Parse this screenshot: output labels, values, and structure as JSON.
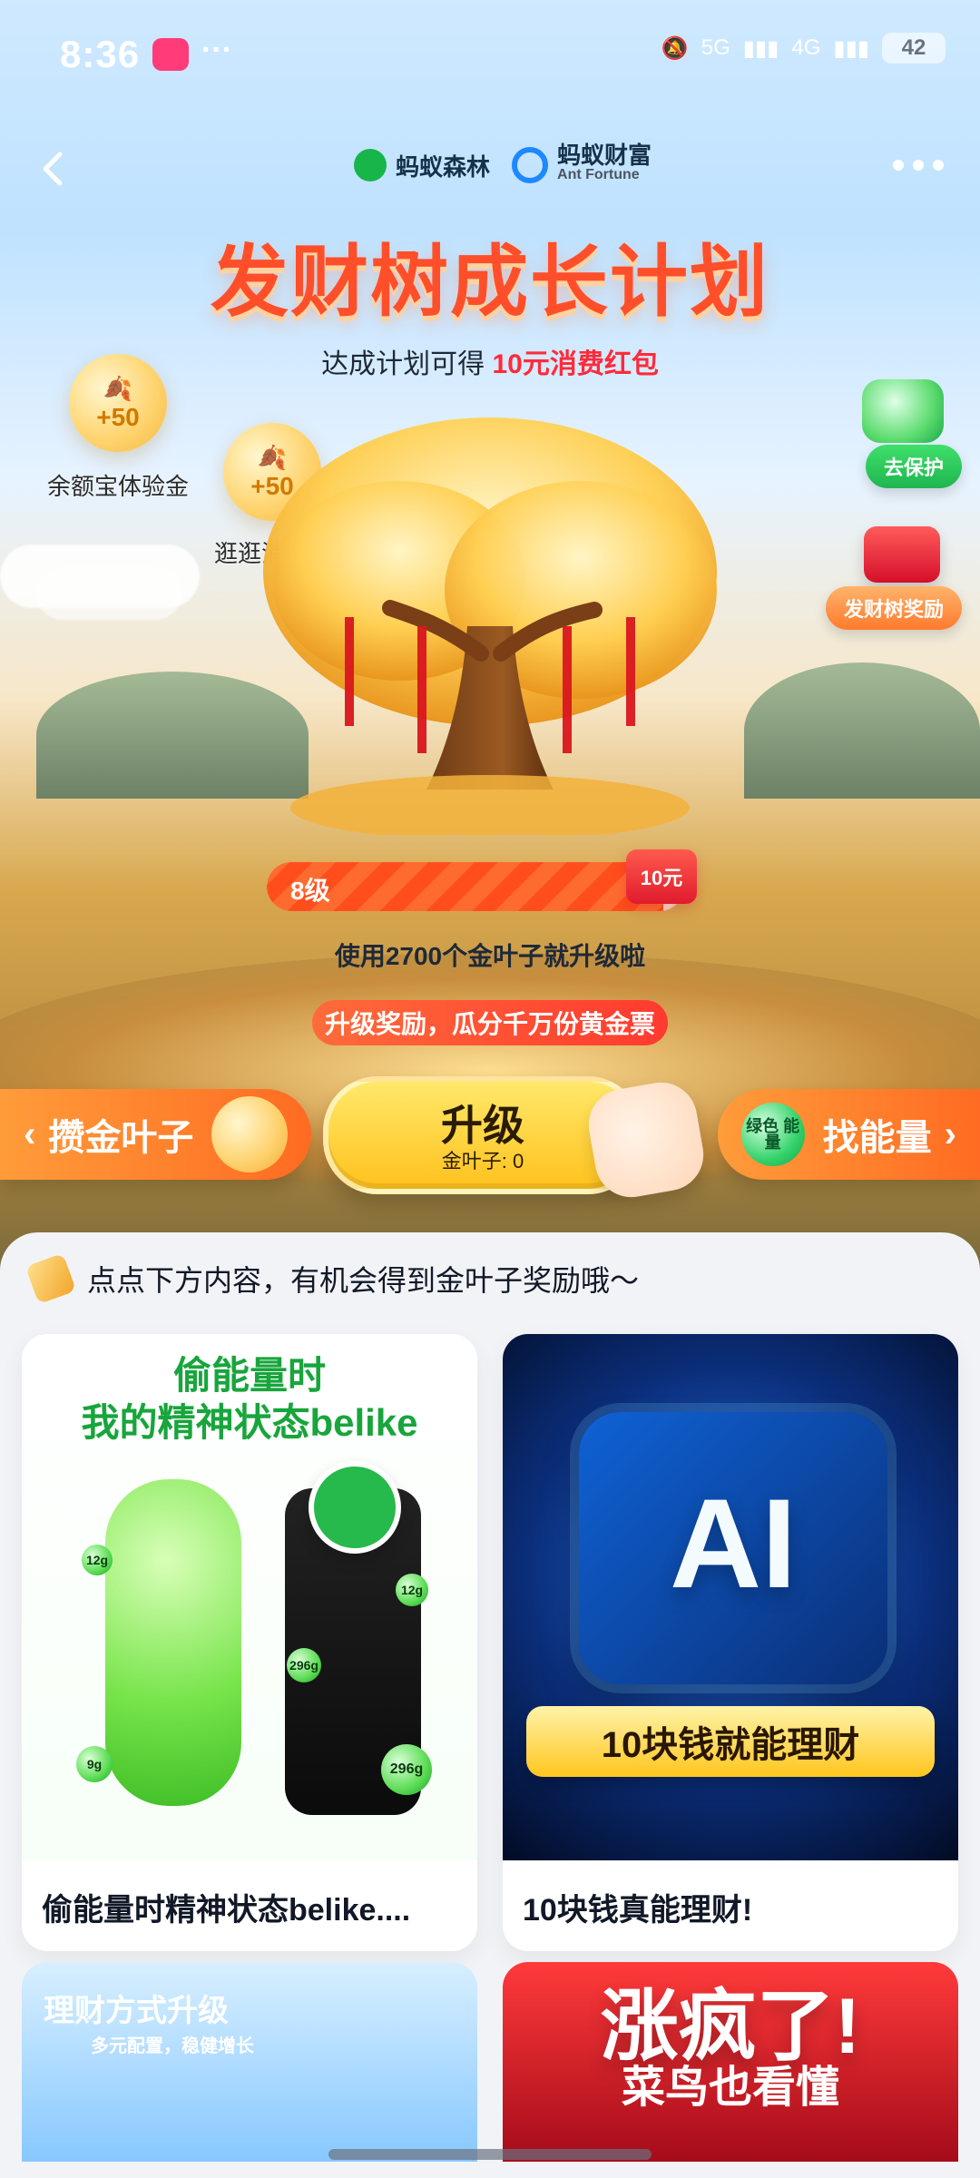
{
  "status_bar": {
    "time": "8:36",
    "extra": "···",
    "network_1": "5G",
    "network_2": "4G",
    "battery": "42"
  },
  "nav": {
    "brand_1": "蚂蚁森林",
    "brand_2": "蚂蚁财富",
    "brand_2_en": "Ant Fortune"
  },
  "hero": {
    "title": "发财树成长计划",
    "subtitle_prefix": "达成计划可得",
    "subtitle_highlight": "10元消费红包",
    "left_rewards": [
      {
        "value": "+50",
        "label": "余额宝体验金"
      },
      {
        "value": "+50",
        "label": "逛逛消费金"
      }
    ],
    "side_actions": {
      "protect_label": "去保护",
      "reward_label": "发财树奖励"
    },
    "level": {
      "label": "8级",
      "badge": "10元",
      "progress_percent": 95
    },
    "hint": "使用2700个金叶子就升级啦",
    "reward_banner": "升级奖励，瓜分千万份黄金票"
  },
  "actions": {
    "left_label": "攒金叶子",
    "center_title": "升级",
    "center_sub": "金叶子: 0",
    "right_label": "找能量",
    "right_badge": "绿色\n能量"
  },
  "panel": {
    "header": "点点下方内容，有机会得到金叶子奖励哦～",
    "cards": [
      {
        "image_text_1": "偷能量时",
        "image_text_2": "我的精神状态belike",
        "caption": "偷能量时精神状态belike...."
      },
      {
        "image_text_1": "AI",
        "image_text_2": "10块钱就能理财",
        "caption": "10块钱真能理财!"
      }
    ],
    "bottom_cards": [
      {
        "title": "理财方式升级",
        "sub": "多元配置，稳健增长"
      },
      {
        "title": "涨疯了!",
        "sub": "菜鸟也看懂"
      }
    ],
    "stickers": [
      "12g",
      "12g",
      "296g",
      "9g",
      "296g"
    ]
  }
}
